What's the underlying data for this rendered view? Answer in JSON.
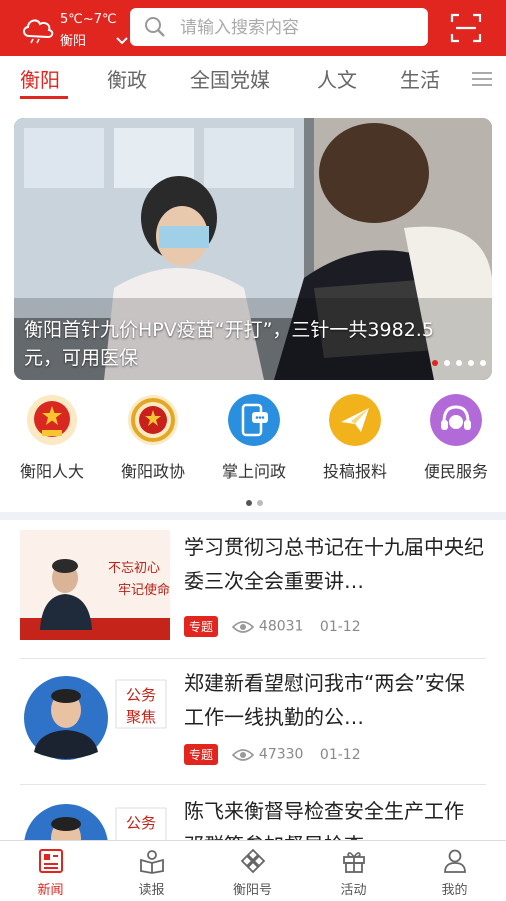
{
  "header": {
    "temperature": "5℃~7℃",
    "city": "衡阳",
    "search_placeholder": "请输入搜索内容",
    "icons": [
      "cloud-weather-icon",
      "chevron-down-icon",
      "search-icon",
      "scan-icon"
    ]
  },
  "tabs": [
    {
      "label": "衡阳",
      "active": true
    },
    {
      "label": "衡政",
      "active": false
    },
    {
      "label": "全国党媒",
      "active": false
    },
    {
      "label": "人文",
      "active": false
    },
    {
      "label": "生活",
      "active": false
    }
  ],
  "banner": {
    "caption": "衡阳首针九价HPV疫苗“开打”，三针一共3982.5元，可用医保",
    "slide_count": 5,
    "active_slide": 1
  },
  "shortcuts": [
    {
      "label": "衡阳人大",
      "icon": "national-emblem-icon",
      "color": "#d9281f"
    },
    {
      "label": "衡阳政协",
      "icon": "cppcc-emblem-icon",
      "color": "#c8201a"
    },
    {
      "label": "掌上问政",
      "icon": "phone-chat-icon",
      "color": "#2b8fe0"
    },
    {
      "label": "投稿报料",
      "icon": "paper-plane-icon",
      "color": "#f2b21b"
    },
    {
      "label": "便民服务",
      "icon": "headset-service-icon",
      "color": "#b26ad8"
    }
  ],
  "shortcut_pages": {
    "count": 2,
    "active": 1
  },
  "articles": [
    {
      "title": "学习贯彻习总书记在十九届中央纪委三次全会重要讲…",
      "badge": "专题",
      "views": "48031",
      "date": "01-12",
      "thumb_text": "不忘初心 牢记使命"
    },
    {
      "title": "郑建新看望慰问我市“两会”安保工作一线执勤的公…",
      "badge": "专题",
      "views": "47330",
      "date": "01-12",
      "thumb_text": "公务聚焦"
    },
    {
      "title": "陈飞来衡督导检查安全生产工作 邓群策参加督导检查",
      "badge": "",
      "views": "",
      "date": "",
      "thumb_text": "公务"
    }
  ],
  "bottom_nav": [
    {
      "label": "新闻",
      "icon": "news-icon",
      "active": true
    },
    {
      "label": "读报",
      "icon": "newspaper-reader-icon",
      "active": false
    },
    {
      "label": "衡阳号",
      "icon": "diamond-grid-icon",
      "active": false
    },
    {
      "label": "活动",
      "icon": "gift-icon",
      "active": false
    },
    {
      "label": "我的",
      "icon": "user-icon",
      "active": false
    }
  ],
  "colors": {
    "brand": "#e0261f",
    "inactive": "#666666"
  }
}
